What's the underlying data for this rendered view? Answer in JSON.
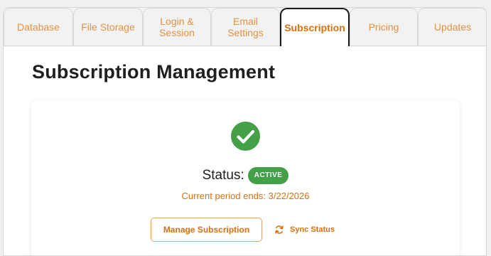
{
  "tabs": [
    {
      "label": "Database",
      "active": false
    },
    {
      "label": "File Storage",
      "active": false
    },
    {
      "label": "Login &\nSession",
      "active": false
    },
    {
      "label": "Email\nSettings",
      "active": false
    },
    {
      "label": "Subscription",
      "active": true
    },
    {
      "label": "Pricing",
      "active": false
    },
    {
      "label": "Updates",
      "active": false
    }
  ],
  "page": {
    "title": "Subscription Management"
  },
  "subscription": {
    "status_icon": "check-circle-icon",
    "status_label": "Status:",
    "status_badge": "ACTIVE",
    "period_text": "Current period ends: 3/22/2026",
    "manage_button_label": "Manage Subscription",
    "sync_icon": "sync-icon",
    "sync_button_label": "Sync Status"
  },
  "colors": {
    "accent": "#d9700f",
    "tab_text": "#e8913f",
    "success": "#43a047"
  }
}
